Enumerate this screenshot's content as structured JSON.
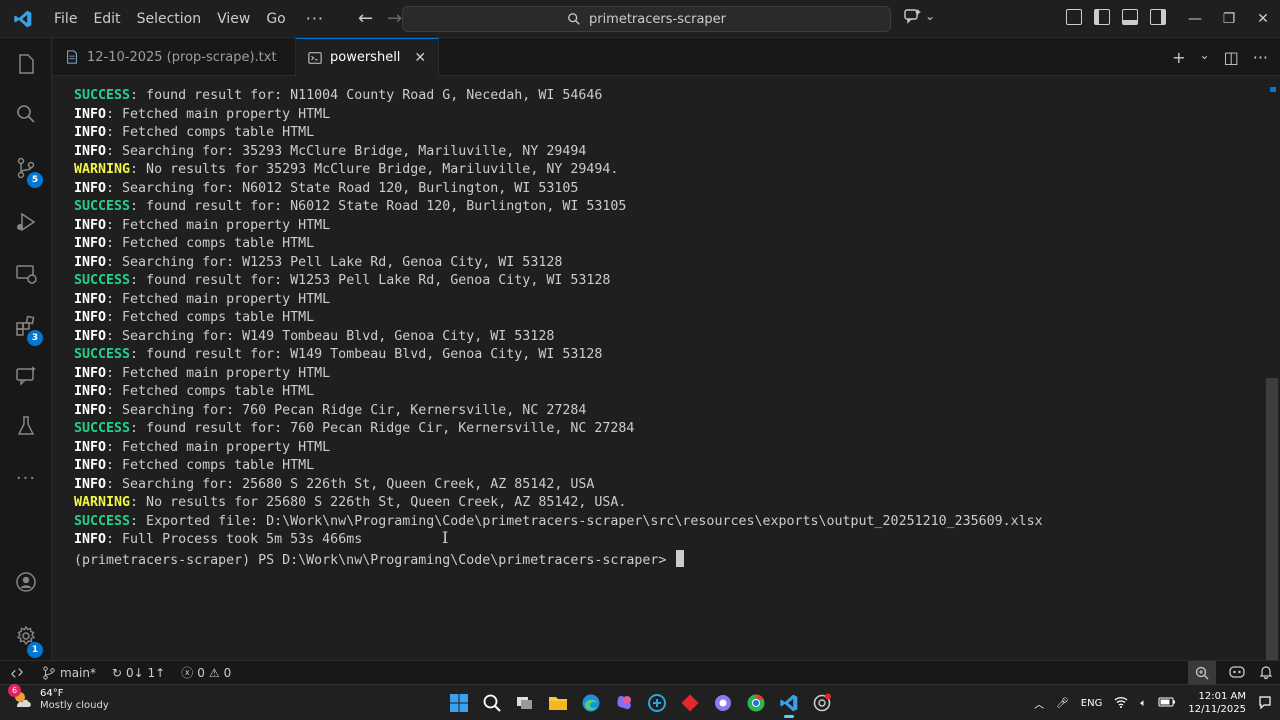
{
  "titlebar": {
    "menu": [
      "File",
      "Edit",
      "Selection",
      "View",
      "Go"
    ],
    "more": "···",
    "search_text": "primetracers-scraper"
  },
  "activity": {
    "source_control_badge": "5",
    "extensions_badge": "3",
    "manage_badge": "1"
  },
  "tabs": [
    {
      "label": "12-10-2025 (prop-scrape).txt",
      "active": false
    },
    {
      "label": "powershell",
      "active": true
    }
  ],
  "terminal": {
    "lines": [
      {
        "level": "SUCCESS",
        "text": ": found result for: N11004 County Road G, Necedah, WI 54646"
      },
      {
        "level": "INFO",
        "text": ": Fetched main property HTML"
      },
      {
        "level": "INFO",
        "text": ": Fetched comps table HTML"
      },
      {
        "level": "INFO",
        "text": ": Searching for: 35293 McClure Bridge, Mariluville, NY 29494"
      },
      {
        "level": "WARNING",
        "text": ": No results for 35293 McClure Bridge, Mariluville, NY 29494."
      },
      {
        "level": "INFO",
        "text": ": Searching for: N6012 State Road 120, Burlington, WI 53105"
      },
      {
        "level": "SUCCESS",
        "text": ": found result for: N6012 State Road 120, Burlington, WI 53105"
      },
      {
        "level": "INFO",
        "text": ": Fetched main property HTML"
      },
      {
        "level": "INFO",
        "text": ": Fetched comps table HTML"
      },
      {
        "level": "INFO",
        "text": ": Searching for: W1253 Pell Lake Rd, Genoa City, WI 53128"
      },
      {
        "level": "SUCCESS",
        "text": ": found result for: W1253 Pell Lake Rd, Genoa City, WI 53128"
      },
      {
        "level": "INFO",
        "text": ": Fetched main property HTML"
      },
      {
        "level": "INFO",
        "text": ": Fetched comps table HTML"
      },
      {
        "level": "INFO",
        "text": ": Searching for: W149 Tombeau Blvd, Genoa City, WI 53128"
      },
      {
        "level": "SUCCESS",
        "text": ": found result for: W149 Tombeau Blvd, Genoa City, WI 53128"
      },
      {
        "level": "INFO",
        "text": ": Fetched main property HTML"
      },
      {
        "level": "INFO",
        "text": ": Fetched comps table HTML"
      },
      {
        "level": "INFO",
        "text": ": Searching for: 760 Pecan Ridge Cir, Kernersville, NC 27284"
      },
      {
        "level": "SUCCESS",
        "text": ": found result for: 760 Pecan Ridge Cir, Kernersville, NC 27284"
      },
      {
        "level": "INFO",
        "text": ": Fetched main property HTML"
      },
      {
        "level": "INFO",
        "text": ": Fetched comps table HTML"
      },
      {
        "level": "INFO",
        "text": ": Searching for: 25680 S 226th St, Queen Creek, AZ 85142, USA"
      },
      {
        "level": "WARNING",
        "text": ": No results for 25680 S 226th St, Queen Creek, AZ 85142, USA."
      },
      {
        "level": "SUCCESS",
        "text": ": Exported file: D:\\Work\\nw\\Programing\\Code\\primetracers-scraper\\src\\resources\\exports\\output_20251210_235609.xlsx"
      },
      {
        "level": "INFO",
        "text": ": Full Process took 5m 53s 466ms"
      }
    ],
    "prompt": "(primetracers-scraper) PS D:\\Work\\nw\\Programing\\Code\\primetracers-scraper> "
  },
  "statusbar": {
    "branch": "main*",
    "sync": "0↓ 1↑",
    "errors": "0",
    "warnings": "0"
  },
  "taskbar": {
    "weather_temp": "64°F",
    "weather_desc": "Mostly cloudy",
    "weather_badge": "6",
    "lang": "ENG",
    "time": "12:01 AM",
    "date": "12/11/2025"
  },
  "colors": {
    "success": "#23d18b",
    "warning": "#f5f543",
    "accent": "#0078d4"
  }
}
